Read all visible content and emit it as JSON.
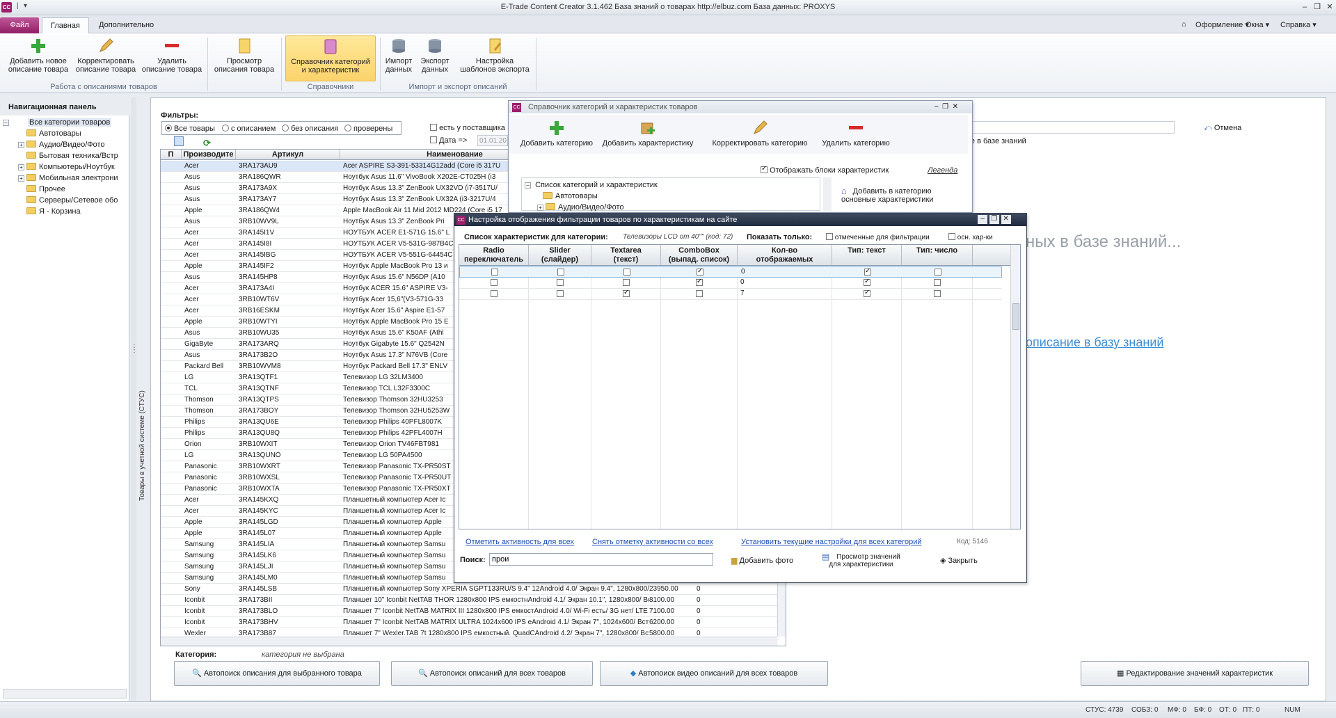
{
  "app": {
    "icon": "CC",
    "title": "E-Trade Content Creator 3.1.462     База знаний о товарах     http://elbuz.com     База данных: PROXYS"
  },
  "tabs": {
    "file": "Файл",
    "main": "Главная",
    "extra": "Дополнительно"
  },
  "right_tabs": {
    "design": "Оформление",
    "windows": "Окна",
    "help": "Справка"
  },
  "ribbon": {
    "add": "Добавить новое\nописание товара",
    "edit": "Корректировать\nописание товара",
    "delete": "Удалить\nописание товара",
    "view": "Просмотр\nописания товара",
    "catalog": "Справочник категорий\nи характеристик",
    "import": "Импорт\nданных",
    "export": "Экспорт\nданных",
    "templates": "Настройка\nшаблонов экспорта",
    "group1": "Работа с описаниями товаров",
    "group2": "Справочники",
    "group3": "Импорт и экспорт описаний"
  },
  "nav": {
    "header": "Навигационная панель",
    "root": "Все категории товаров",
    "items": [
      "Автотовары",
      "Аудио/Видео/Фото",
      "Бытовая техника/Встр",
      "Компьютеры/Ноутбук",
      "Мобильная электрони",
      "Прочее",
      "Серверы/Сетевое обо",
      "Я - Корзина"
    ]
  },
  "side_tab": "Товары в учетной системе (СТУС)",
  "filters": {
    "title": "Фильтры:",
    "all": "Все товары",
    "with": "с описанием",
    "without": "без описания",
    "checked": "проверены",
    "supplier": "есть у поставщика",
    "date": "Дата =>",
    "date_value": "01.01.20"
  },
  "grid": {
    "headers": [
      "П",
      "Производите",
      "Артикул",
      "Наименование"
    ],
    "rows": [
      [
        "1",
        "Acer",
        "3RA173AU9",
        "Acer ASPIRE S3-391-53314G12add (Core i5 317U"
      ],
      [
        "1",
        "Asus",
        "3RA186QWR",
        "Ноутбук Asus 11.6\" VivoBook X202E-CT025H (i3"
      ],
      [
        "1",
        "Asus",
        "3RA173A9X",
        "Ноутбук Asus 13.3\" ZenBook UX32VD (i7-3517U/"
      ],
      [
        "1",
        "Asus",
        "3RA173AY7",
        "Ноутбук Asus 13.3\" ZenBook UX32A (i3-3217U/4"
      ],
      [
        "1",
        "Apple",
        "3RA186QW4",
        "Apple MacBook Air 11 Mid 2012 MD224 (Core i5 17"
      ],
      [
        "1",
        "Asus",
        "3RB10WV9L",
        "Ноутбук Asus 13.3\" ZenBook Pri"
      ],
      [
        "1",
        "Acer",
        "3RA145I1V",
        "НОУТБУК ACER E1-571G 15.6\" L"
      ],
      [
        "1",
        "Acer",
        "3RA145I8I",
        "НОУТБУК ACER V5-531G-987B4C"
      ],
      [
        "1",
        "Acer",
        "3RA145IBG",
        "НОУТБУК ACER V5-551G-64454C"
      ],
      [
        "1",
        "Apple",
        "3RA145IF2",
        "Ноутбук Apple MacBook Pro 13 и"
      ],
      [
        "1",
        "Asus",
        "3RA145HP8",
        "Ноутбук Asus 15.6\" N56DP (A10"
      ],
      [
        "1",
        "Acer",
        "3RA173A4I",
        "Ноутбук ACER 15.6\" ASPIRE V3-"
      ],
      [
        "1",
        "Acer",
        "3RB10WT6V",
        "Ноутбук Acer 15,6\"(V3-571G-33"
      ],
      [
        "0",
        "Acer",
        "3RB16ESKM",
        "Ноутбук Acer 15.6\" Aspire E1-57"
      ],
      [
        "0",
        "Apple",
        "3RB10WTYI",
        "Ноутбук Apple MacBook Pro 15 E"
      ],
      [
        "1",
        "Asus",
        "3RB10WU35",
        "Ноутбук Asus 15.6\" K50AF (Athl"
      ],
      [
        "1",
        "GigaByte",
        "3RA173ARQ",
        "Ноутбук Gigabyte 15.6\" Q2542N"
      ],
      [
        "0",
        "Asus",
        "3RA173B2O",
        "Ноутбук Asus 17.3\" N76VB (Core"
      ],
      [
        "1",
        "Packard Bell",
        "3RB10WVM8",
        "Ноутбук Packard Bell 17.3\" ENLV"
      ],
      [
        "0",
        "LG",
        "3RA13QTF1",
        "Телевизор LG 32LM3400"
      ],
      [
        "0",
        "TCL",
        "3RA13QTNF",
        "Телевизор TCL L32F3300C"
      ],
      [
        "0",
        "Thomson",
        "3RA13QTPS",
        "Телевизор Thomson 32HU3253"
      ],
      [
        "0",
        "Thomson",
        "3RA173BOY",
        "Телевизор Thomson 32HU5253W"
      ],
      [
        "0",
        "Philips",
        "3RA13QU6E",
        "Телевизор Philips 40PFL8007K"
      ],
      [
        "0",
        "Philips",
        "3RA13QU8Q",
        "Телевизор Philips 42PFL4007H"
      ],
      [
        "0",
        "Orion",
        "3RB10WXIT",
        "Телевизор Orion TV46FBT981"
      ],
      [
        "0",
        "LG",
        "3RA13QUNO",
        "Телевизор LG 50PA4500"
      ],
      [
        "0",
        "Panasonic",
        "3RB10WXRT",
        "Телевизор Panasonic TX-PR50ST"
      ],
      [
        "0",
        "Panasonic",
        "3RB10WXSL",
        "Телевизор Panasonic TX-PR50UT"
      ],
      [
        "0",
        "Panasonic",
        "3RB10WXTA",
        "Телевизор Panasonic TX-PR50XT"
      ],
      [
        "0",
        "Acer",
        "3RA145KXQ",
        "Планшетный компьютер Acer Ic"
      ],
      [
        "0",
        "Acer",
        "3RA145KYC",
        "Планшетный компьютер Acer Ic"
      ],
      [
        "0",
        "Apple",
        "3RA145LGD",
        "Планшетный компьютер Apple"
      ],
      [
        "0",
        "Apple",
        "3RA145L07",
        "Планшетный компьютер Apple"
      ],
      [
        "0",
        "Samsung",
        "3RA145LIA",
        "Планшетный компьютер Samsu"
      ],
      [
        "0",
        "Samsung",
        "3RA145LK6",
        "Планшетный компьютер Samsu"
      ],
      [
        "0",
        "Samsung",
        "3RA145LJI",
        "Планшетный компьютер Samsu"
      ],
      [
        "0",
        "Samsung",
        "3RA145LM0",
        "Планшетный компьютер Samsu"
      ],
      [
        "0",
        "Sony",
        "3RA145LSB",
        "Планшетный компьютер Sony XPERIA SGPT133RU/S 9.4\" 12Android 4.0/ Экран 9.4\", 1280x800/ Встр"
      ],
      [
        "0",
        "Iconbit",
        "3RA173BII",
        "Планшет 10\" Iconbit NetTAB THOR 1280x800 IPS емкостнAndroid 4.1/ Экран 10.1\", 1280x800/ Встр"
      ],
      [
        "0",
        "Iconbit",
        "3RA173BLO",
        "Планшет 7\" Iconbit NetTAB MATRIX III 1280x800 IPS емкостAndroid 4.0/ Wi-Fi есть/ 3G нет/ LTE не"
      ],
      [
        "0",
        "Iconbit",
        "3RA173BHV",
        "Планшет 7\" Iconbit NetTAB MATRIX ULTRA 1024x600 IPS еAndroid 4.1/ Экран 7\", 1024x600/ Встро"
      ],
      [
        "0",
        "Wexler",
        "3RA173B87",
        "Планшет 7\" Wexler.TAB 7t 1280x800 IPS емкостный. QuadCAndroid 4.2/ Экран 7\", 1280x800/ Встро"
      ]
    ],
    "extra": [
      [
        "23950.00",
        "0"
      ],
      [
        "8100.00",
        "0"
      ],
      [
        "7100.00",
        "0"
      ],
      [
        "6200.00",
        "0"
      ],
      [
        "5800.00",
        "0"
      ]
    ]
  },
  "category": {
    "label": "Категория:",
    "value": "категория не выбрана"
  },
  "bottom_buttons": {
    "auto_one": "Автопоиск описания для выбранного товара",
    "auto_all": "Автопоиск описаний для всех товаров",
    "auto_video": "Автопоиск видео описаний для всех товаров",
    "edit_values": "Редактирование значений характеристик"
  },
  "bg_text": {
    "cancel": "Отмена",
    "kb": "ке в базе знаний",
    "big": "ных в базе знаний...",
    "link": "описание в базу знаний"
  },
  "catalog_win": {
    "title": "Справочник категорий и характеристик товаров",
    "add_cat": "Добавить категорию",
    "add_char": "Добавить характеристику",
    "edit_cat": "Корректировать категорию",
    "del_cat": "Удалить категорию",
    "show_blocks": "Отображать блоки характеристик",
    "legend": "Легенда",
    "tree_root": "Список категорий и характеристик",
    "tree_1": "Автотовары",
    "tree_2": "Аудио/Видео/Фото",
    "add_basic": "Добавить в категорию\nосновные характеристики"
  },
  "filter_win": {
    "title": "Настройка отображения  фильтрации товаров по характеристикам на сайте",
    "list_label": "Список характеристик для категории:",
    "category": "Телевизоры LCD от 40\"\" (код: 72)",
    "show_only": "Показать только:",
    "marked": "отмеченные для фильтрации",
    "basic": "осн. хар-ки",
    "headers": [
      "Radio\nпереключатель",
      "Slider\n(слайдер)",
      "Textarea\n(текст)",
      "ComboBox\n(выпад. список)",
      "Кол-во\nотображаемых",
      "Тип: текст",
      "Тип: число"
    ],
    "rows": [
      [
        0,
        0,
        0,
        1,
        "0",
        1,
        0
      ],
      [
        0,
        0,
        0,
        1,
        "0",
        1,
        0
      ],
      [
        0,
        0,
        1,
        0,
        "7",
        1,
        0
      ]
    ],
    "link1": "Отметить активность для всех",
    "link2": "Снять отметку активности со всех",
    "link3": "Установить текущие настройки для всех категорий",
    "code": "Код: 5146",
    "search_label": "Поиск:",
    "search_value": "прои",
    "add_photo": "Добавить фото",
    "view_values": "Просмотр значений\nдля характеристики",
    "close": "Закрыть"
  },
  "status": {
    "stus": "СТУС: 4739",
    "sobz": "СОБЗ: 0",
    "mf": "МФ: 0",
    "bf": "БФ: 0",
    "ot": "ОТ: 0",
    "pt": "ПТ: 0",
    "num": "NUM"
  }
}
